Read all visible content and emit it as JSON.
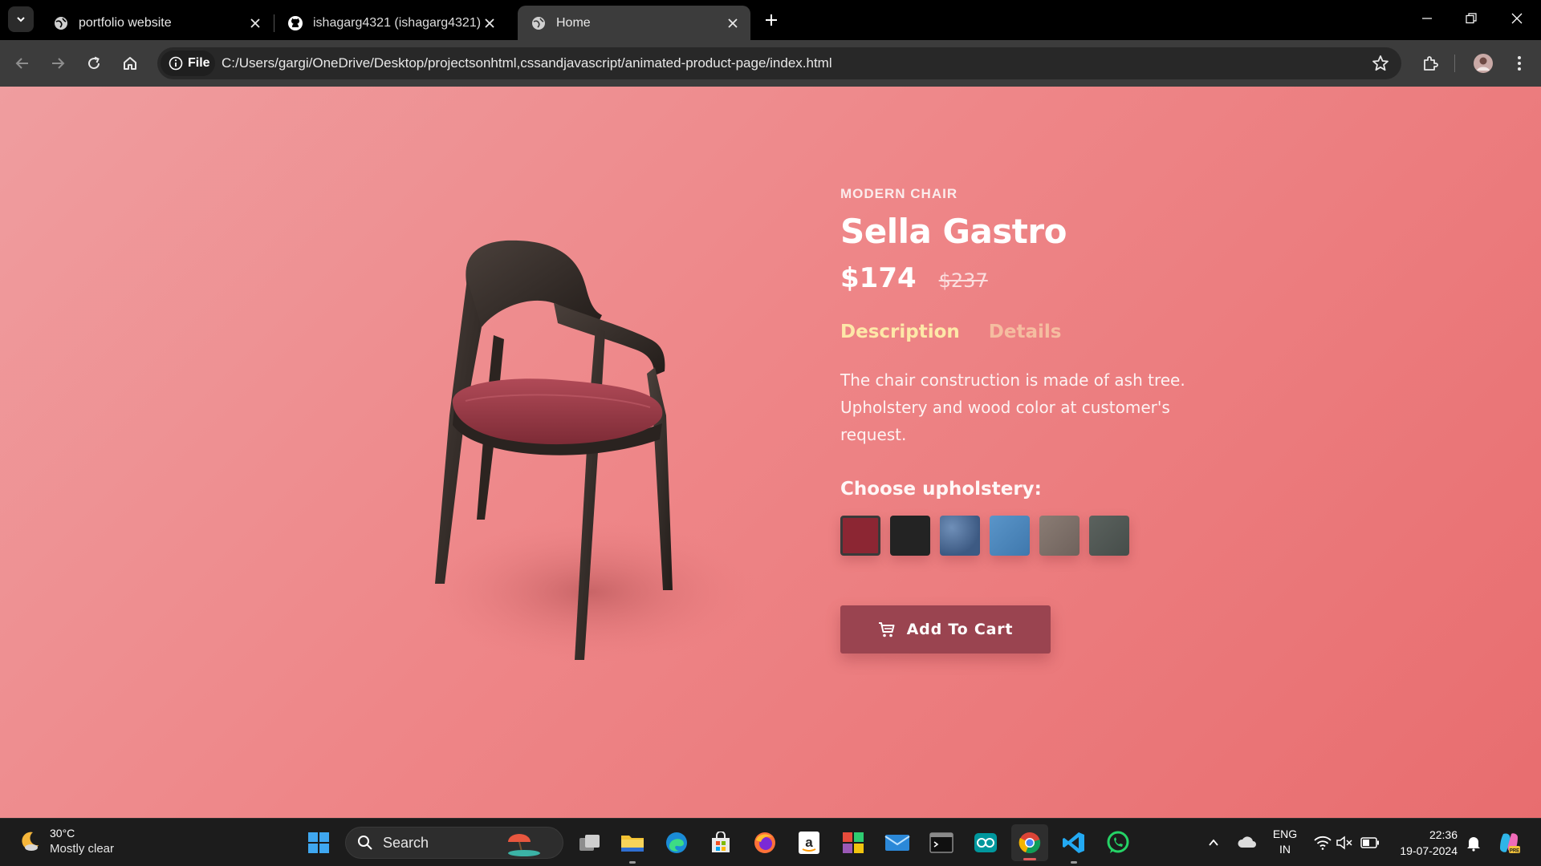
{
  "browser": {
    "tabs": [
      {
        "title": "portfolio website",
        "icon": "globe-icon",
        "active": false
      },
      {
        "title": "ishagarg4321 (ishagarg4321) / ",
        "icon": "github-icon",
        "active": false
      },
      {
        "title": "Home",
        "icon": "globe-icon",
        "active": true
      }
    ],
    "address": {
      "chip_label": "File",
      "url": "C:/Users/gargi/OneDrive/Desktop/projectsonhtml,cssandjavascript/animated-product-page/index.html"
    }
  },
  "product": {
    "category": "MODERN CHAIR",
    "name": "Sella Gastro",
    "price": "$174",
    "old_price": "$237",
    "tabs": [
      "Description",
      "Details"
    ],
    "active_tab": "Description",
    "description": "The chair construction is made of ash tree. Upholstery and wood color at customer's request.",
    "upholstery_heading": "Choose upholstery:",
    "swatches": [
      {
        "name": "burgundy",
        "color": "#8c2633",
        "selected": true
      },
      {
        "name": "black",
        "color": "#232323",
        "selected": false
      },
      {
        "name": "navy-texture",
        "color": "#4a6b96",
        "selected": false
      },
      {
        "name": "denim",
        "color": "#4b86bd",
        "selected": false
      },
      {
        "name": "taupe",
        "color": "#7d6f68",
        "selected": false
      },
      {
        "name": "slate",
        "color": "#4f5652",
        "selected": false
      }
    ],
    "cart_button": "Add To Cart",
    "colors": {
      "accent_tab": "#fde8a8",
      "button": "#9a4450",
      "background_start": "#ef9d9f",
      "background_end": "#e86d6f"
    }
  },
  "taskbar": {
    "weather": {
      "temp": "30°C",
      "condition": "Mostly clear"
    },
    "search_placeholder": "Search",
    "language": {
      "line1": "ENG",
      "line2": "IN"
    },
    "clock": {
      "time": "22:36",
      "date": "19-07-2024"
    },
    "apps": [
      "start-icon",
      "task-view-icon",
      "file-explorer-icon",
      "edge-icon",
      "store-icon",
      "firefox-icon",
      "amazon-icon",
      "office-icon",
      "mail-icon",
      "terminal-icon",
      "arduino-icon",
      "chrome-icon",
      "vscode-icon",
      "whatsapp-icon"
    ]
  }
}
